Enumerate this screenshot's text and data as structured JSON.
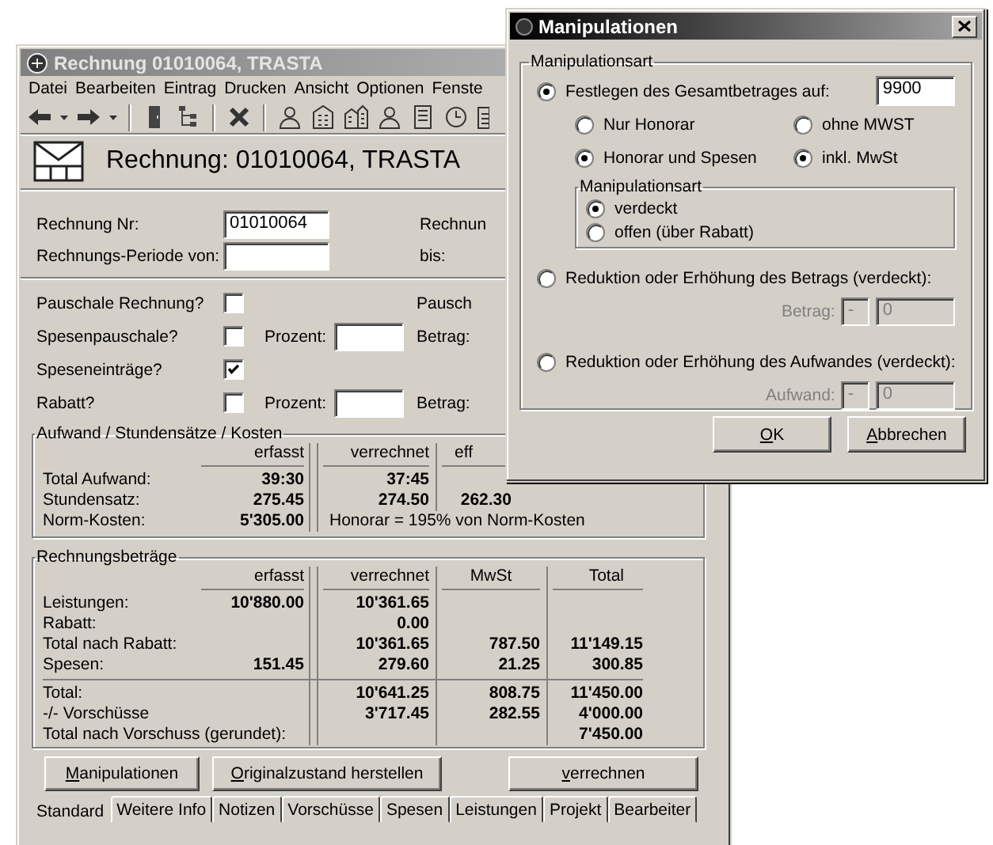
{
  "main_window": {
    "title": "Rechnung 01010064, TRASTA",
    "menu": [
      "Datei",
      "Bearbeiten",
      "Eintrag",
      "Drucken",
      "Ansicht",
      "Optionen",
      "Fenste"
    ],
    "header": "Rechnung: 01010064, TRASTA",
    "fields": [
      {
        "label": "Rechnung Nr:",
        "value": "01010064",
        "side_label": "Rechnun"
      },
      {
        "label": "Rechnungs-Periode von:",
        "side_label": "bis:"
      }
    ],
    "options": [
      {
        "label": "Pauschale Rechnung?",
        "checked": false,
        "side_label": "Pausch"
      },
      {
        "label": "Spesenpauschale?",
        "checked": false,
        "percent_label": "Prozent:",
        "side_label": "Betrag:"
      },
      {
        "label": "Speseneinträge?",
        "checked": true
      },
      {
        "label": "Rabatt?",
        "checked": false,
        "percent_label": "Prozent:",
        "side_label": "Betrag:"
      }
    ],
    "effort_group": {
      "title": "Aufwand / Stundensätze / Kosten",
      "columns": [
        "erfasst",
        "verrechnet",
        "eff"
      ],
      "rows": [
        {
          "label": "Total Aufwand:",
          "cells": [
            "39:30",
            "37:45",
            null
          ]
        },
        {
          "label": "Stundensatz:",
          "cells": [
            "275.45",
            "274.50",
            "262.30"
          ]
        },
        {
          "label": "Norm-Kosten:",
          "cells": [
            "5'305.00"
          ],
          "note": "Honorar = 195% von Norm-Kosten"
        }
      ]
    },
    "amounts_group": {
      "title": "Rechnungsbeträge",
      "columns": [
        "erfasst",
        "verrechnet",
        "MwSt",
        "Total"
      ],
      "sections": [
        [
          {
            "label": "Leistungen:",
            "cells": [
              "10'880.00",
              "10'361.65",
              null,
              null
            ]
          },
          {
            "label": "Rabatt:",
            "cells": [
              null,
              "0.00",
              null,
              null
            ]
          },
          {
            "label": "Total nach Rabatt:",
            "cells": [
              null,
              "10'361.65",
              "787.50",
              "11'149.15"
            ]
          },
          {
            "label": "Spesen:",
            "cells": [
              "151.45",
              "279.60",
              "21.25",
              "300.85"
            ]
          }
        ],
        [
          {
            "label": "Total:",
            "cells": [
              null,
              "10'641.25",
              "808.75",
              "11'450.00"
            ]
          },
          {
            "label": "-/- Vorschüsse",
            "cells": [
              null,
              "3'717.45",
              "282.55",
              "4'000.00"
            ]
          },
          {
            "label": "Total nach Vorschuss (gerundet):",
            "cells": [
              null,
              null,
              null,
              "7'450.00"
            ]
          }
        ]
      ]
    },
    "buttons": [
      "Manipulationen",
      "Originalzustand herstellen",
      "verrechnen"
    ],
    "tabs": [
      {
        "label": "Standard",
        "selected": true
      },
      {
        "label": "Weitere Info",
        "selected": false
      },
      {
        "label": "Notizen",
        "selected": false
      },
      {
        "label": "Vorschüsse",
        "selected": false
      },
      {
        "label": "Spesen",
        "selected": false
      },
      {
        "label": "Leistungen",
        "selected": false
      },
      {
        "label": "Projekt",
        "selected": false
      },
      {
        "label": "Bearbeiter",
        "selected": false
      }
    ]
  },
  "dialog": {
    "title": "Manipulationen",
    "group_title": "Manipulationsart",
    "modes": [
      {
        "kind": "total",
        "label": "Festlegen des Gesamtbetrages auf:",
        "selected": true,
        "value": "9900",
        "scope": [
          {
            "label": "Nur Honorar",
            "selected": false
          },
          {
            "label": "Honorar und Spesen",
            "selected": true
          }
        ],
        "vat": [
          {
            "label": "ohne MWST",
            "selected": false
          },
          {
            "label": "inkl. MwSt",
            "selected": true
          }
        ],
        "method": {
          "title": "Manipulationsart",
          "options": [
            {
              "label": "verdeckt",
              "selected": true
            },
            {
              "label": "offen (über Rabatt)",
              "selected": false
            }
          ]
        }
      },
      {
        "kind": "delta",
        "label": "Reduktion oder Erhöhung des Betrags (verdeckt):",
        "selected": false,
        "field_label": "Betrag:",
        "sign": "-",
        "value": "0",
        "disabled": true
      },
      {
        "kind": "delta",
        "label": "Reduktion oder Erhöhung des Aufwandes (verdeckt):",
        "selected": false,
        "field_label": "Aufwand:",
        "sign": "-",
        "value": "0",
        "disabled": true
      }
    ],
    "buttons": [
      "OK",
      "Abbrechen"
    ]
  }
}
